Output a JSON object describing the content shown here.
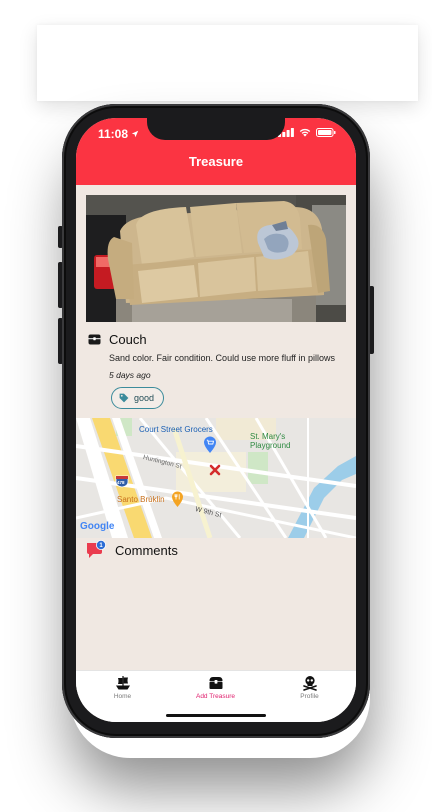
{
  "status_bar": {
    "time": "11:08"
  },
  "header": {
    "title": "Treasure"
  },
  "item": {
    "title": "Couch",
    "description": "Sand color. Fair condition. Could use more fluff in pillows",
    "posted_ago": "5 days ago",
    "tags": [
      {
        "label": "good"
      }
    ]
  },
  "map": {
    "labels": {
      "poi_grocer": "Court Street Grocers",
      "poi_playground": "St. Mary's Playground",
      "street_huntington": "Huntington St",
      "street_w9th": "W 9th St",
      "poi_restaurant": "Santo Brúklin",
      "highway_shield": "478",
      "attribution": "Google"
    }
  },
  "comments": {
    "label": "Comments",
    "count": "1"
  },
  "tabbar": {
    "tabs": [
      {
        "label": "Home",
        "active": false
      },
      {
        "label": "Add Treasure",
        "active": true
      },
      {
        "label": "Profile",
        "active": false
      }
    ]
  },
  "colors": {
    "header": "#fb3442",
    "background": "#f0e8e2",
    "active_tab": "#e01f6d",
    "tag_border": "#3b8b9b"
  }
}
